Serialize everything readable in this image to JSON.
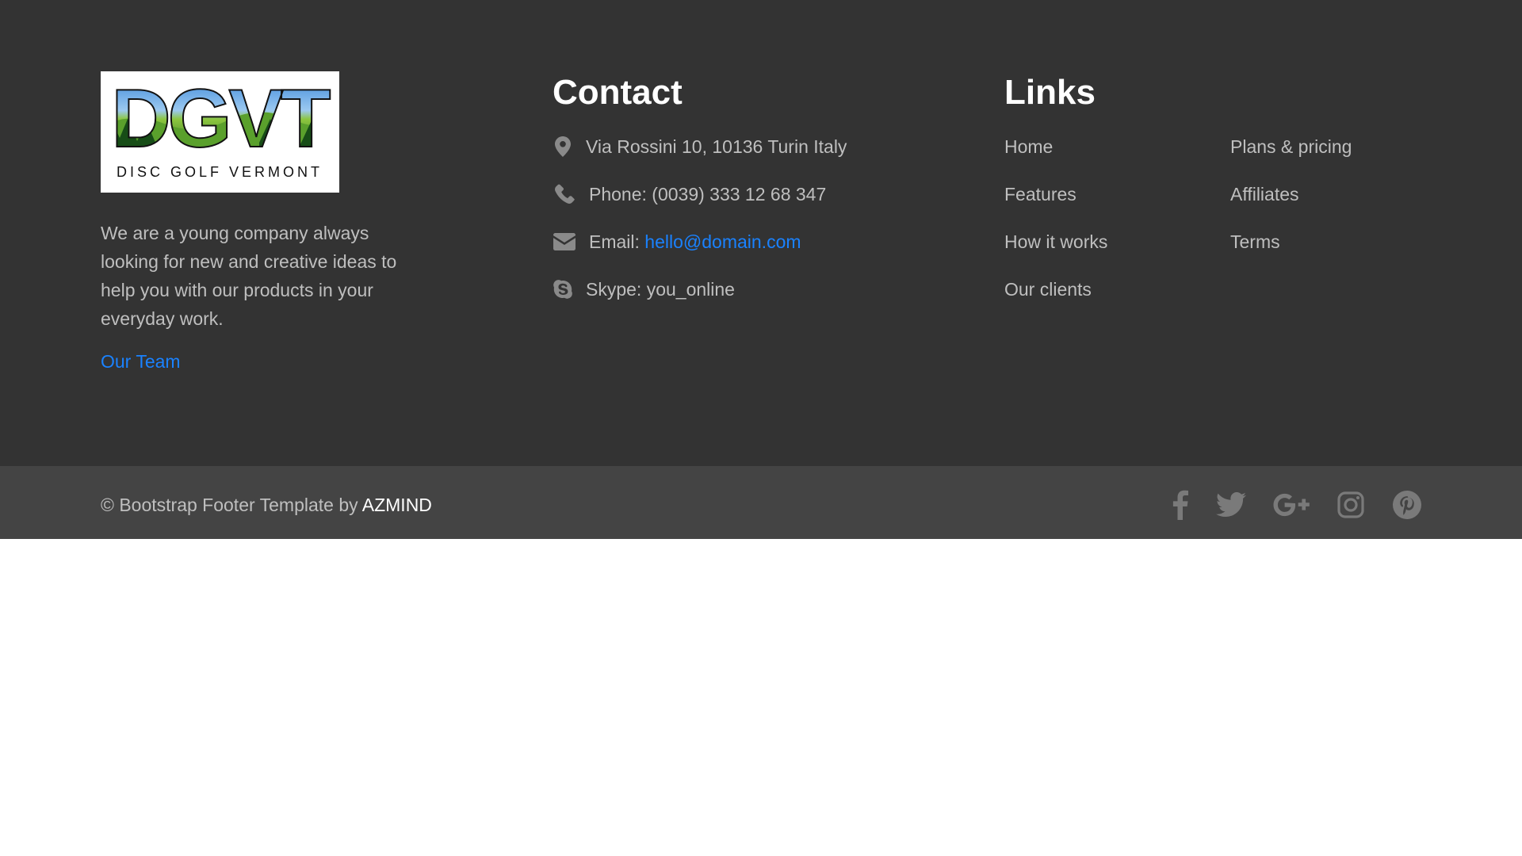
{
  "colors": {
    "top_bg": "#333333",
    "bottom_bg": "#444444",
    "text": "#bfbfbf",
    "link": "#1a82ff",
    "icon": "#8a8a8a"
  },
  "logo": {
    "letters": "DGVT",
    "tagline": "DISC GOLF VERMONT"
  },
  "about": {
    "text": "We are a young company always looking for new and creative ideas to help you with our products in your everyday work.",
    "team_link": "Our Team"
  },
  "contact": {
    "heading": "Contact",
    "address": {
      "icon": "map-marker-icon",
      "text": "Via Rossini 10, 10136 Turin Italy"
    },
    "phone": {
      "icon": "phone-icon",
      "text": "Phone: (0039) 333 12 68 347"
    },
    "email": {
      "icon": "envelope-icon",
      "label": "Email: ",
      "value": "hello@domain.com"
    },
    "skype": {
      "icon": "skype-icon",
      "text": "Skype: you_online"
    }
  },
  "links": {
    "heading": "Links",
    "column1": [
      "Home",
      "Features",
      "How it works",
      "Our clients"
    ],
    "column2": [
      "Plans & pricing",
      "Affiliates",
      "Terms"
    ]
  },
  "bottom": {
    "copyright_prefix": "© Bootstrap Footer Template by ",
    "copyright_brand": "AZMIND",
    "social": [
      "facebook-icon",
      "twitter-icon",
      "google-plus-icon",
      "instagram-icon",
      "pinterest-icon"
    ]
  }
}
